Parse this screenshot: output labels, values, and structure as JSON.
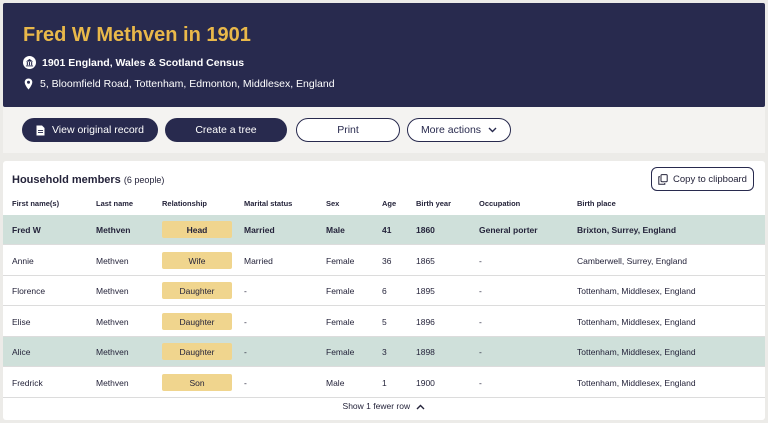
{
  "header": {
    "title": "Fred W Methven in 1901",
    "census": "1901 England, Wales & Scotland Census",
    "address": "5, Bloomfield Road, Tottenham, Edmonton, Middlesex, England"
  },
  "actions": {
    "view_original": "View original record",
    "create_tree": "Create a tree",
    "print": "Print",
    "more_actions": "More actions"
  },
  "household": {
    "title": "Household members",
    "count": "(6 people)",
    "copy_label": "Copy to clipboard",
    "columns": [
      "First name(s)",
      "Last name",
      "Relationship",
      "Marital status",
      "Sex",
      "Age",
      "Birth year",
      "Occupation",
      "Birth place"
    ],
    "rows": [
      {
        "first": "Fred W",
        "last": "Methven",
        "relationship": "Head",
        "marital": "Married",
        "sex": "Male",
        "age": "41",
        "birth_year": "1860",
        "occupation": "General porter",
        "birth_place": "Brixton, Surrey, England"
      },
      {
        "first": "Annie",
        "last": "Methven",
        "relationship": "Wife",
        "marital": "Married",
        "sex": "Female",
        "age": "36",
        "birth_year": "1865",
        "occupation": "-",
        "birth_place": "Camberwell, Surrey, England"
      },
      {
        "first": "Florence",
        "last": "Methven",
        "relationship": "Daughter",
        "marital": "-",
        "sex": "Female",
        "age": "6",
        "birth_year": "1895",
        "occupation": "-",
        "birth_place": "Tottenham, Middlesex, England"
      },
      {
        "first": "Elise",
        "last": "Methven",
        "relationship": "Daughter",
        "marital": "-",
        "sex": "Female",
        "age": "5",
        "birth_year": "1896",
        "occupation": "-",
        "birth_place": "Tottenham, Middlesex, England"
      },
      {
        "first": "Alice",
        "last": "Methven",
        "relationship": "Daughter",
        "marital": "-",
        "sex": "Female",
        "age": "3",
        "birth_year": "1898",
        "occupation": "-",
        "birth_place": "Tottenham, Middlesex, England"
      },
      {
        "first": "Fredrick",
        "last": "Methven",
        "relationship": "Son",
        "marital": "-",
        "sex": "Male",
        "age": "1",
        "birth_year": "1900",
        "occupation": "-",
        "birth_place": "Tottenham, Middlesex, England"
      }
    ],
    "show_fewer": "Show 1 fewer row"
  },
  "icons": {
    "census": "building-icon",
    "address": "location-pin-icon",
    "view_original": "document-icon",
    "more_actions": "chevron-down-icon",
    "copy": "copy-icon",
    "show_fewer": "chevron-up-icon"
  },
  "colors": {
    "header_bg": "#282a4e",
    "title": "#e9b84a",
    "highlight_row": "#cfe0da",
    "relationship_badge": "#f0d58e"
  }
}
